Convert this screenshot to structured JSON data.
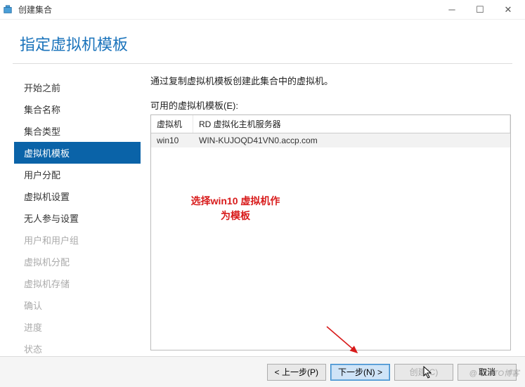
{
  "window": {
    "title": "创建集合"
  },
  "header": {
    "title": "指定虚拟机模板"
  },
  "sidebar": {
    "items": [
      {
        "label": "开始之前"
      },
      {
        "label": "集合名称"
      },
      {
        "label": "集合类型"
      },
      {
        "label": "虚拟机模板"
      },
      {
        "label": "用户分配"
      },
      {
        "label": "虚拟机设置"
      },
      {
        "label": "无人参与设置"
      },
      {
        "label": "用户和用户组"
      },
      {
        "label": "虚拟机分配"
      },
      {
        "label": "虚拟机存储"
      },
      {
        "label": "确认"
      },
      {
        "label": "进度"
      },
      {
        "label": "状态"
      }
    ]
  },
  "main": {
    "intro": "通过复制虚拟机模板创建此集合中的虚拟机。",
    "list_label": "可用的虚拟机模板(E):",
    "columns": {
      "vm": "虚拟机",
      "host": "RD 虚拟化主机服务器"
    },
    "rows": [
      {
        "vm": "win10",
        "host": "WIN-KUJOQD41VN0.accp.com"
      }
    ],
    "annotation_line1": "选择win10 虚拟机作",
    "annotation_line2": "为模板"
  },
  "footer": {
    "prev": "< 上一步(P)",
    "next": "下一步(N) >",
    "create": "创建(C)",
    "cancel": "取消"
  },
  "watermark": "@ 51CTO博客"
}
